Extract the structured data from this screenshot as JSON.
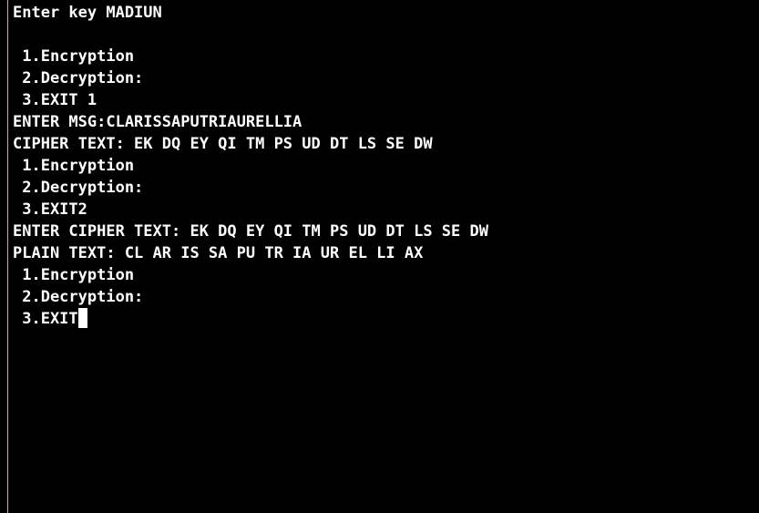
{
  "console": {
    "lines": [
      "Enter key MADIUN",
      "",
      " 1.Encryption",
      " 2.Decryption:",
      " 3.EXIT 1",
      "ENTER MSG:CLARISSAPUTRIAURELLIA",
      "CIPHER TEXT: EK DQ EY QI TM PS UD DT LS SE DW",
      " 1.Encryption",
      " 2.Decryption:",
      " 3.EXIT2",
      "ENTER CIPHER TEXT: EK DQ EY QI TM PS UD DT LS SE DW",
      "PLAIN TEXT: CL AR IS SA PU TR IA UR EL LI AX",
      " 1.Encryption",
      " 2.Decryption:",
      " 3.EXIT"
    ]
  },
  "colors": {
    "background": "#000000",
    "text": "#ffffff",
    "border": "#d9a2a2"
  }
}
